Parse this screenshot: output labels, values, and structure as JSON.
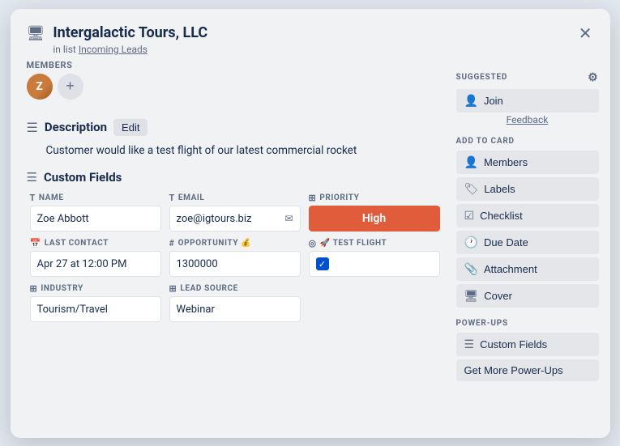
{
  "modal": {
    "title": "Intergalactic Tours, LLC",
    "in_list_label": "in list",
    "in_list_link": "Incoming Leads",
    "close_label": "✕"
  },
  "members_section": {
    "label": "MEMBERS",
    "add_label": "+"
  },
  "description": {
    "title": "Description",
    "edit_label": "Edit",
    "text": "Customer would like a test flight of our latest commercial rocket"
  },
  "custom_fields": {
    "title": "Custom Fields",
    "fields": [
      {
        "id": "name",
        "icon": "T",
        "label": "NAME",
        "value": "Zoe Abbott",
        "type": "text"
      },
      {
        "id": "email",
        "icon": "T",
        "label": "EMAIL",
        "value": "zoe@igtours.biz",
        "type": "email"
      },
      {
        "id": "priority",
        "icon": "grid",
        "label": "PRIORITY",
        "value": "High",
        "type": "priority-high"
      },
      {
        "id": "last_contact",
        "icon": "cal",
        "label": "LAST CONTACT",
        "value": "Apr 27 at 12:00 PM",
        "type": "text"
      },
      {
        "id": "opportunity",
        "icon": "#",
        "label": "OPPORTUNITY 💰",
        "value": "1300000",
        "type": "text"
      },
      {
        "id": "test_flight",
        "icon": "circle-check",
        "label": "🚀 TEST FLIGHT",
        "value": "",
        "type": "checkbox"
      },
      {
        "id": "industry",
        "icon": "grid",
        "label": "INDUSTRY",
        "value": "Tourism/Travel",
        "type": "text"
      },
      {
        "id": "lead_source",
        "icon": "grid",
        "label": "LEAD SOURCE",
        "value": "Webinar",
        "type": "text"
      }
    ]
  },
  "sidebar": {
    "suggested_label": "SUGGESTED",
    "join_label": "Join",
    "feedback_label": "Feedback",
    "add_to_card_label": "ADD TO CARD",
    "buttons": [
      {
        "id": "members",
        "icon": "👤",
        "label": "Members"
      },
      {
        "id": "labels",
        "icon": "🏷",
        "label": "Labels"
      },
      {
        "id": "checklist",
        "icon": "✅",
        "label": "Checklist"
      },
      {
        "id": "due_date",
        "icon": "🕐",
        "label": "Due Date"
      },
      {
        "id": "attachment",
        "icon": "📎",
        "label": "Attachment"
      },
      {
        "id": "cover",
        "icon": "🖥",
        "label": "Cover"
      }
    ],
    "power_ups_label": "POWER-UPS",
    "power_up_buttons": [
      {
        "id": "custom_fields",
        "icon": "☰",
        "label": "Custom Fields"
      },
      {
        "id": "get_more",
        "icon": "",
        "label": "Get More Power-Ups"
      }
    ]
  }
}
